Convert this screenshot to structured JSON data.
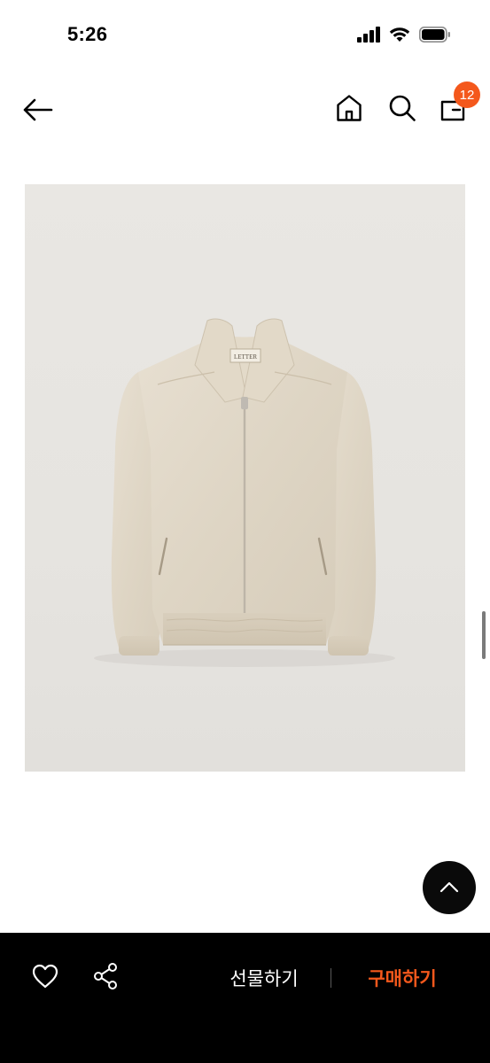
{
  "status_bar": {
    "time": "5:26"
  },
  "nav": {
    "cart_count": "12",
    "badge_color": "#f4581c"
  },
  "product": {
    "label_text": "LETTER",
    "image_subject": "beige zip-up jacket"
  },
  "actions": {
    "gift_label": "선물하기",
    "buy_label": "구매하기",
    "buy_color": "#f4581c"
  },
  "icons": {
    "back": "arrow-left-icon",
    "home": "home-icon",
    "search": "search-icon",
    "bag": "shopping-bag-icon",
    "wish": "heart-icon",
    "share": "share-icon",
    "scroll_top": "chevron-up-icon"
  }
}
